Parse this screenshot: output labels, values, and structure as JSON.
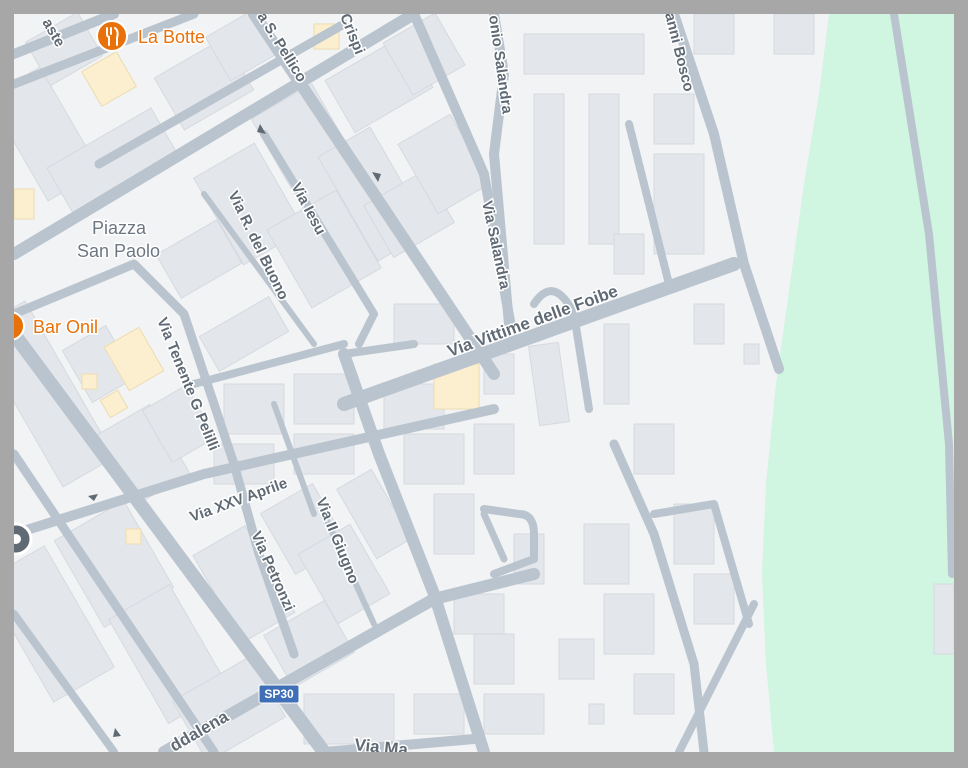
{
  "map": {
    "pois": [
      {
        "name": "La Botte",
        "icon": "restaurant-icon"
      },
      {
        "name": "Bar Onil",
        "icon": "bar-icon"
      }
    ],
    "places": {
      "line1": "Piazza",
      "line2": "San Paolo"
    },
    "route_shield": "SP30",
    "streets": {
      "s_pellico": "a S. Pellico",
      "crispi": "Crispi",
      "nio_salandra": "onio Salandra",
      "anni_bosco": "anni Bosco",
      "via_iesu": "Via Iesu",
      "via_r_del_buono": "Via R. del Buono",
      "via_salandra": "Via Salandra",
      "via_vittime_delle_foibe": "Via Vittime delle Foibe",
      "via_tenente_g_pelilli": "Via Tenente G Pelilli",
      "via_xxv_aprile": "Via XXV Aprile",
      "via_ii_giugno": "Via II Giugno",
      "via_petronzi": "Via Petronzi",
      "ddalena": "ddalena",
      "via_ma": "Via Ma",
      "aste": "aste"
    },
    "colors": {
      "background": "#f1f3f4",
      "road": "#bac4ce",
      "road_edge": "#a9b4c0",
      "building": "#e3e6ea",
      "building_highlight": "#fcefd0",
      "park": "#d0f5e0",
      "poi": "#e8710a",
      "shield": "#3f6fb6"
    }
  }
}
